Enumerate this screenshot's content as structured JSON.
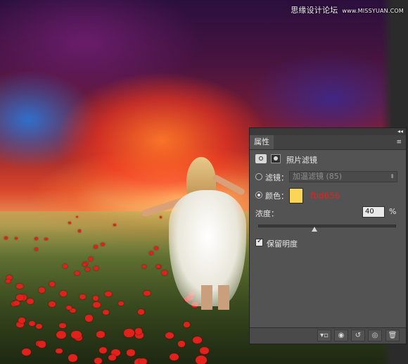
{
  "watermark": {
    "text": "思缘设计论坛",
    "url": "www.MISSYUAN.COM"
  },
  "panel": {
    "tab_label": "属性",
    "collapse_glyph": "◂◂",
    "menu_glyph": "≡",
    "adjustment_title": "照片滤镜",
    "filter": {
      "label": "滤镜：",
      "value": "加温滤镜 (85)",
      "selected": false
    },
    "color": {
      "label": "颜色：",
      "hex_text": "fbd656",
      "swatch": "#fbd656",
      "selected": true
    },
    "density": {
      "label": "浓度：",
      "value": "40",
      "unit": "%",
      "level": 0.4
    },
    "preserve_luminosity": {
      "label": "保留明度",
      "checked": true
    },
    "footer_icons": [
      "clip-to-layer-icon",
      "view-previous-icon",
      "reset-icon",
      "visibility-eye-icon",
      "trash-icon"
    ]
  }
}
